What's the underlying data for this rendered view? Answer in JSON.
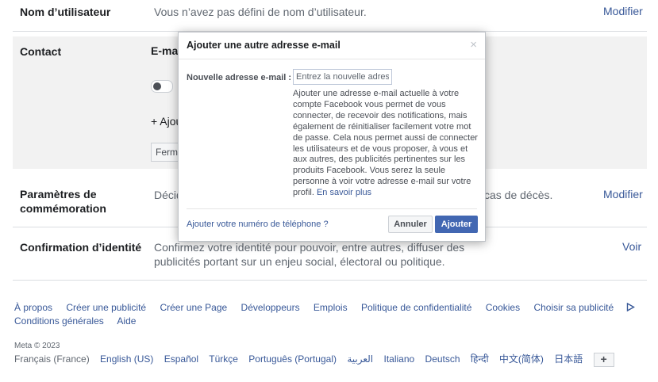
{
  "settings": {
    "username": {
      "label": "Nom d’utilisateur",
      "value": "Vous n’avez pas défini de nom d’utilisateur.",
      "action": "Modifier"
    },
    "contact": {
      "label": "Contact",
      "email_label": "E-mai",
      "add_label": "+ Ajou",
      "close_label": "Ferme"
    },
    "memorial": {
      "label_line1": "Paramètres de",
      "label_line2": "commémoration",
      "value_start": "Décid",
      "value_end": "cas de décès.",
      "action": "Modifier"
    },
    "identity": {
      "label": "Confirmation d’identité",
      "value_line1": "Confirmez votre identité pour pouvoir, entre autres, diffuser des",
      "value_line2": "publicités portant sur un enjeu social, électoral ou politique.",
      "action": "Voir"
    }
  },
  "modal": {
    "title": "Ajouter une autre adresse e-mail",
    "close_glyph": "×",
    "field_label": "Nouvelle adresse e-mail :",
    "input_placeholder": "Entrez la nouvelle adresse",
    "help_text": "Ajouter une adresse e-mail actuelle à votre compte Facebook vous permet de vous connecter, de recevoir des notifications, mais également de réinitialiser facilement votre mot de passe. Cela nous permet aussi de connecter les utilisateurs et de vous proposer, à vous et aux autres, des publicités pertinentes sur les produits Facebook. Vous serez la seule personne à voir votre adresse e-mail sur votre profil.",
    "learn_more": "En savoir plus",
    "phone_link": "Ajouter votre numéro de téléphone ?",
    "cancel": "Annuler",
    "add": "Ajouter"
  },
  "footer": {
    "links": [
      "À propos",
      "Créer une publicité",
      "Créer une Page",
      "Développeurs",
      "Emplois",
      "Politique de confidentialité",
      "Cookies",
      "Choisir sa publicité"
    ],
    "links_line2": [
      "Conditions générales",
      "Aide"
    ],
    "copyright": "Meta © 2023",
    "current_language": "Français (France)",
    "languages": [
      "English (US)",
      "Español",
      "Türkçe",
      "Português (Portugal)",
      "العربية",
      "Italiano",
      "Deutsch",
      "हिन्दी",
      "中文(简体)",
      "日本語"
    ],
    "plus": "+"
  },
  "colors": {
    "link": "#385898",
    "primary_button": "#4267b2",
    "panel": "#f2f2f2"
  }
}
